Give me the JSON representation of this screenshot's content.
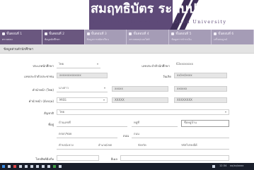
{
  "banner": {
    "title": "สมฤทธิบัตร ระดับปริญญาตรี",
    "subtitle": "Sukhothai Thammathirat Open University"
  },
  "steps": [
    {
      "num": "ขั้นตอนที่ 1",
      "desc": "ตรวจสอบ"
    },
    {
      "num": "ขั้นตอนที่ 2",
      "desc": "ข้อมูลนักศึกษา"
    },
    {
      "num": "ขั้นตอนที่ 3",
      "desc": "ข้อมูลการสมัครเรียน"
    },
    {
      "num": "ขั้นตอนที่ 4",
      "desc": "ตรวจสอบ/แนบไฟล์"
    },
    {
      "num": "ขั้นตอนที่ 5",
      "desc": "ข้อมูลการชำระเงิน"
    },
    {
      "num": "ขั้นตอนที่ 6",
      "desc": "เสร็จสมบูรณ์"
    }
  ],
  "section_title": "ข้อมูลส่วนตัวนักศึกษา",
  "form": {
    "student_type_label": "ประเภทนักศึกษา",
    "student_type_value": "ไทย",
    "student_id_label": "เลขประจำตัวนักศึกษา",
    "student_id_value": "63xxxxxxxx",
    "citizen_id_label": "เลขประจำตัวประชาชน",
    "citizen_id_value": "xxxxxxxxxxxxx",
    "birthdate_label": "วันเกิด",
    "birthdate_value": "xx/xx/xxxx",
    "title_label": "คำนำหน้า (ไทย)",
    "title_value": "นางสาว",
    "first_name_value": "xxxxx",
    "last_name_value": "xxxxxx",
    "title_en_label": "คำนำหน้า (อังกฤษ)",
    "title_en_value": "MISS",
    "first_name_en_value": "XXXXX",
    "last_name_en_value": "XXXXXXXX",
    "nationality_label": "สัญชาติ",
    "nationality_value": "ไทย",
    "address_label": "ที่อยู่",
    "house_no_value": "บ้านเลขที่",
    "moo_value": "หมู่ที่",
    "village_value": "ชื่อหมู่บ้าน",
    "alley_value": "ตรอก/ซอย",
    "road_label": "ถนน",
    "road_value": "ถนน",
    "tambon_value": "ตำบล/แขวง",
    "amphoe_value": "อำเภอ/เขต",
    "province_value": "จังหวัด",
    "postcode_value": "รหัสไปรษณีย์",
    "phone_label": "โทรศัพท์มือถือ",
    "email_label": "อีเมล"
  },
  "taskbar": {
    "clock": "12:34",
    "date": "xx/xx/xxxx"
  }
}
